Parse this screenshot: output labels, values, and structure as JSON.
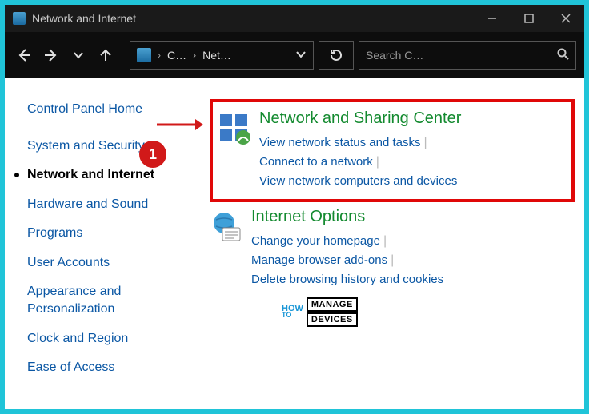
{
  "window": {
    "title": "Network and Internet"
  },
  "breadcrumb": {
    "seg1": "C…",
    "seg2": "Net…"
  },
  "search": {
    "placeholder": "Search C…"
  },
  "sidebar": {
    "home": "Control Panel Home",
    "items": [
      "System and Security",
      "Network and Internet",
      "Hardware and Sound",
      "Programs",
      "User Accounts",
      "Appearance and Personalization",
      "Clock and Region",
      "Ease of Access"
    ],
    "current_index": 1
  },
  "categories": {
    "nsc": {
      "title": "Network and Sharing Center",
      "links": [
        "View network status and tasks",
        "Connect to a network",
        "View network computers and devices"
      ]
    },
    "inet": {
      "title": "Internet Options",
      "links": [
        "Change your homepage",
        "Manage browser add-ons",
        "Delete browsing history and cookies"
      ]
    }
  },
  "annotation": {
    "badge": "1"
  },
  "watermark": {
    "how": "HOW",
    "to": "TO",
    "manage": "MANAGE",
    "devices": "DEVICES"
  }
}
